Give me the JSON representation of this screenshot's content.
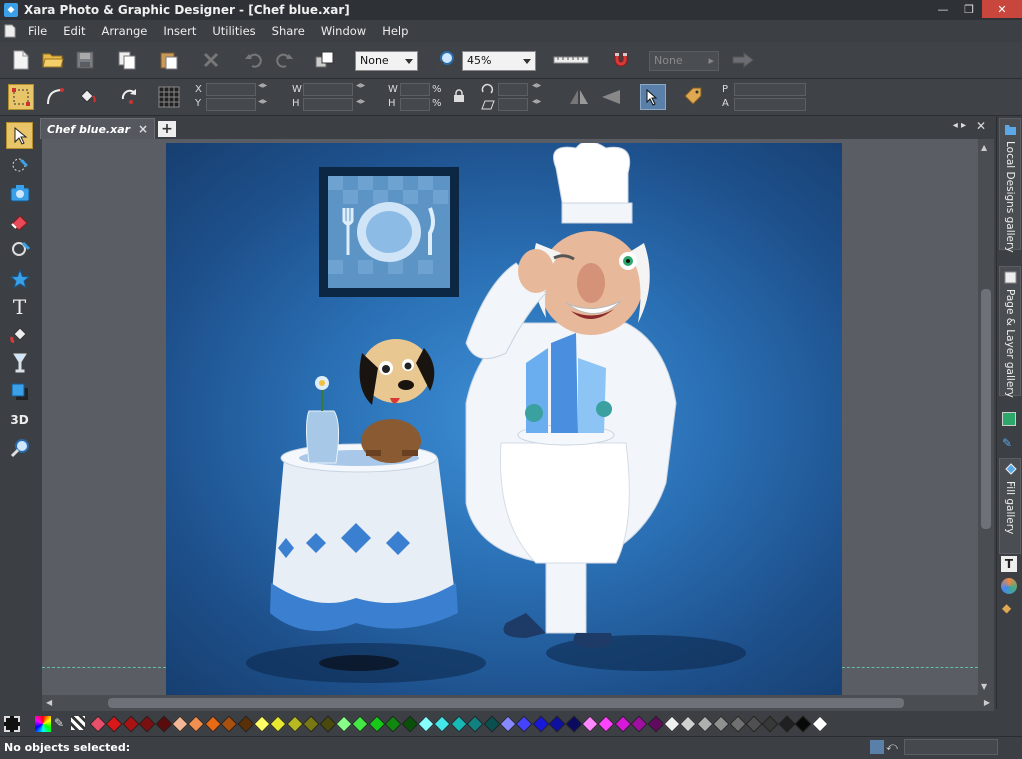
{
  "window": {
    "title": "Xara Photo & Graphic Designer - [Chef blue.xar]"
  },
  "menu": {
    "items": [
      {
        "label": "File"
      },
      {
        "label": "Edit"
      },
      {
        "label": "Arrange"
      },
      {
        "label": "Insert"
      },
      {
        "label": "Utilities"
      },
      {
        "label": "Share"
      },
      {
        "label": "Window"
      },
      {
        "label": "Help"
      }
    ]
  },
  "toolbar": {
    "quality_combo": "None",
    "zoom_combo": "45%",
    "style_combo": "None"
  },
  "infobar": {
    "x_label": "X",
    "y_label": "Y",
    "w_label": "W",
    "h_label": "H",
    "w2_label": "W",
    "h2_label": "H",
    "pct1": "%",
    "pct2": "%",
    "p_label": "P",
    "a_label": "A"
  },
  "tabs": {
    "doc_tab_label": "Chef blue.xar",
    "close_glyph": "×",
    "add_glyph": "+"
  },
  "galleries": [
    {
      "label": "Local Designs gallery"
    },
    {
      "label": "Page & Layer gallery"
    },
    {
      "label": "Fill gallery"
    }
  ],
  "palette_colors": [
    "#e84f6a",
    "#d81818",
    "#a81414",
    "#7a1010",
    "#5a0c0c",
    "#f2b896",
    "#f09050",
    "#e86a14",
    "#a85010",
    "#5a3008",
    "#ffff66",
    "#e8e830",
    "#b8b820",
    "#787814",
    "#4a4a0c",
    "#88ff88",
    "#44e844",
    "#18c818",
    "#108810",
    "#0a500a",
    "#88ffff",
    "#44e8e8",
    "#18b8b8",
    "#108080",
    "#0a5050",
    "#8888ff",
    "#4444ff",
    "#1818d8",
    "#1010a0",
    "#0a0a60",
    "#ff88ff",
    "#ff44ff",
    "#d818d8",
    "#a010a0",
    "#600a60",
    "#f0f0f0",
    "#d0d0d0",
    "#b0b0b0",
    "#909090",
    "#707070",
    "#505050",
    "#383838",
    "#202020",
    "#080808",
    "#ffffff"
  ],
  "status": {
    "message": "No objects selected:"
  }
}
